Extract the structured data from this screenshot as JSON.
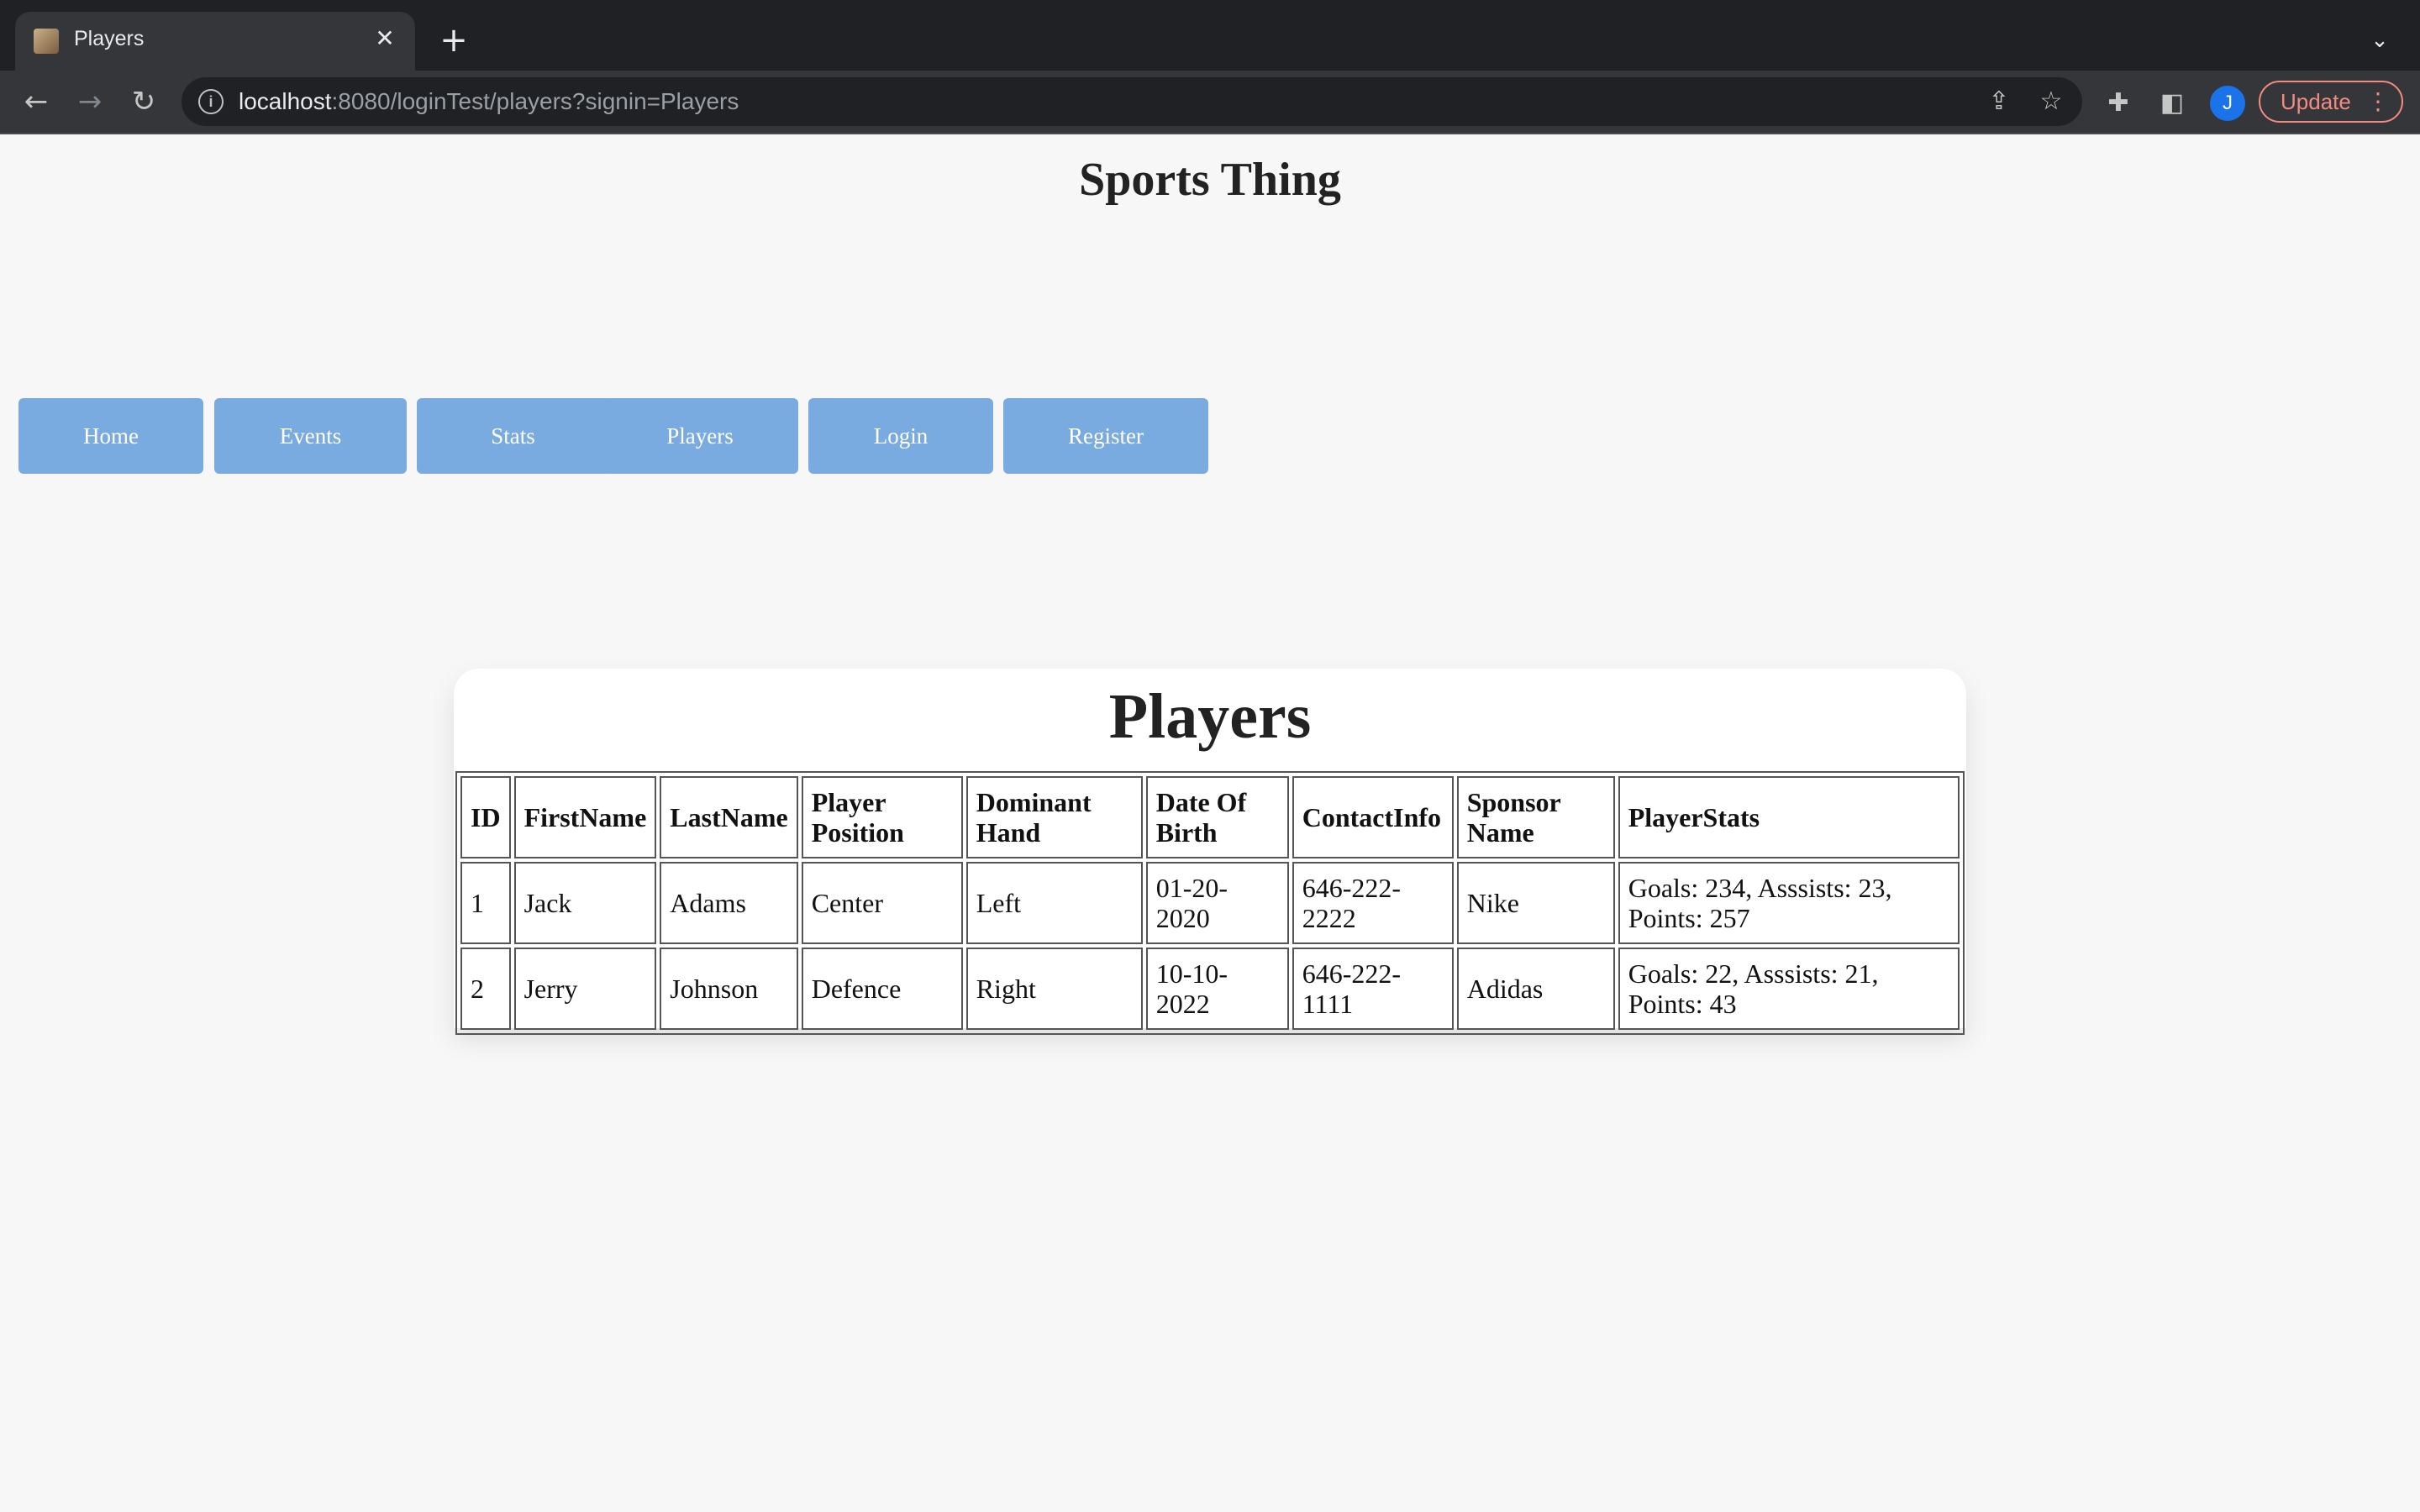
{
  "browser": {
    "tab_title": "Players",
    "url_host": "localhost",
    "url_rest": ":8080/loginTest/players?signin=Players",
    "profile_initial": "J",
    "update_label": "Update"
  },
  "page": {
    "site_title": "Sports Thing",
    "nav": [
      "Home",
      "Events",
      "Stats",
      "Players",
      "Login",
      "Register"
    ],
    "section_title": "Players",
    "table": {
      "headers": [
        "ID",
        "FirstName",
        "LastName",
        "Player Position",
        "Dominant Hand",
        "Date Of Birth",
        "ContactInfo",
        "Sponsor Name",
        "PlayerStats"
      ],
      "rows": [
        [
          "1",
          "Jack",
          "Adams",
          "Center",
          "Left",
          "01-20-2020",
          "646-222-2222",
          "Nike",
          "Goals: 234, Asssists: 23, Points: 257"
        ],
        [
          "2",
          "Jerry",
          "Johnson",
          "Defence",
          "Right",
          "10-10-2022",
          "646-222-1111",
          "Adidas",
          "Goals: 22, Asssists: 21, Points: 43"
        ]
      ]
    }
  },
  "colors": {
    "nav_button": "#7aabe0",
    "page_bg": "#f7f7f7",
    "chrome_dark": "#202124",
    "update_accent": "#f28b82"
  }
}
